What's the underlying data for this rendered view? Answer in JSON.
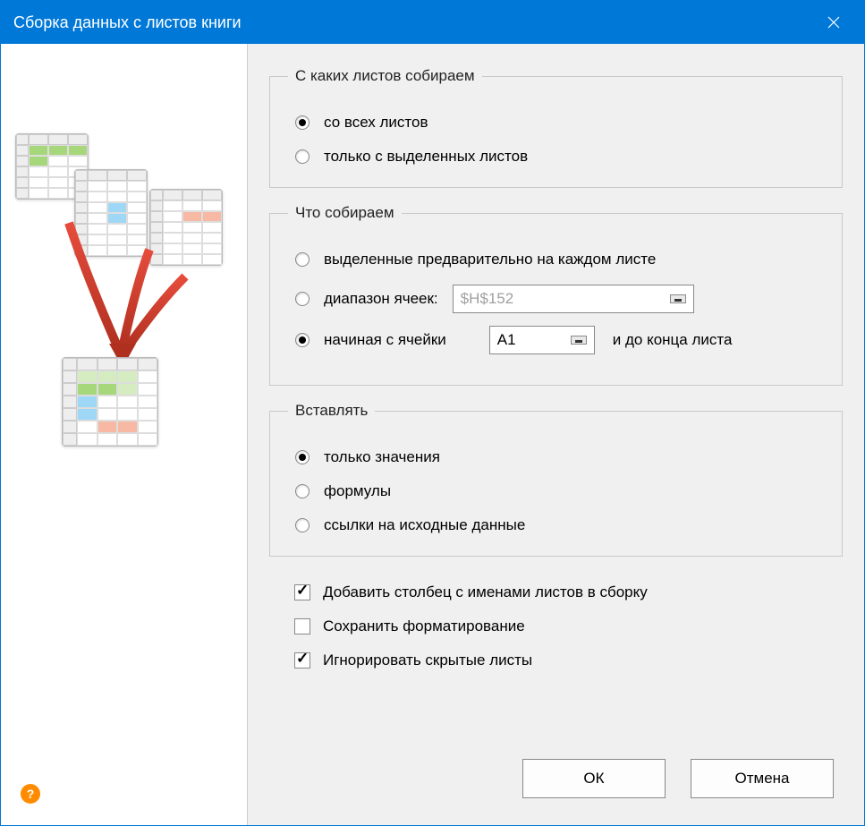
{
  "window": {
    "title": "Сборка данных с листов книги"
  },
  "group_from": {
    "legend": "С каких листов собираем",
    "opt_all": "со всех листов",
    "opt_selected": "только с выделенных листов"
  },
  "group_what": {
    "legend": "Что собираем",
    "opt_preselected": "выделенные предварительно на каждом листе",
    "opt_range_label": "диапазон ячеек:",
    "range_value": "$H$152",
    "opt_start_label": "начиная с ячейки",
    "start_value": "A1",
    "suffix": "и до конца листа"
  },
  "group_insert": {
    "legend": "Вставлять",
    "opt_values": "только значения",
    "opt_formulas": "формулы",
    "opt_links": "ссылки на исходные данные"
  },
  "checks": {
    "add_column": "Добавить столбец с именами листов в сборку",
    "keep_format": "Сохранить форматирование",
    "ignore_hidden": "Игнорировать скрытые листы"
  },
  "buttons": {
    "ok": "ОК",
    "cancel": "Отмена"
  },
  "help": "?"
}
